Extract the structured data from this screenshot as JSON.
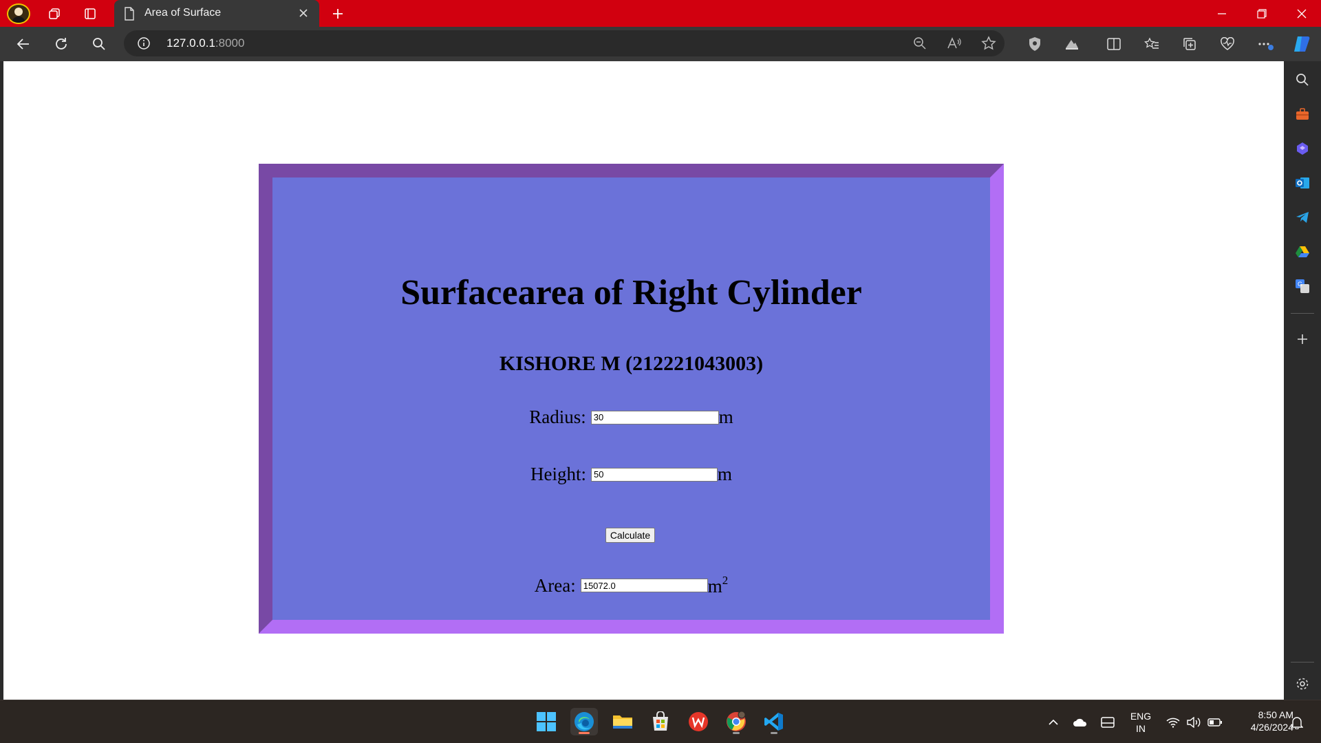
{
  "browser": {
    "tab_title": "Area of Surface",
    "url_host": "127.0.0.1",
    "url_port": ":8000"
  },
  "page": {
    "heading": "Surfacearea of Right Cylinder",
    "author": "KISHORE M (212221043003)",
    "radius": {
      "label": "Radius:",
      "value": "30",
      "unit": "m"
    },
    "height": {
      "label": "Height:",
      "value": "50",
      "unit": "m"
    },
    "calculate_label": "Calculate",
    "area": {
      "label": "Area:",
      "value": "15072.0",
      "unit": "m",
      "unit_power": "2"
    }
  },
  "taskbar": {
    "lang_line1": "ENG",
    "lang_line2": "IN",
    "time": "8:50 AM",
    "date": "4/26/2024"
  },
  "colors": {
    "titlebar": "#d1000f",
    "panel_bg": "#6b72d9",
    "panel_border_dark": "#7849a5",
    "panel_border_light": "#b26ef5"
  }
}
